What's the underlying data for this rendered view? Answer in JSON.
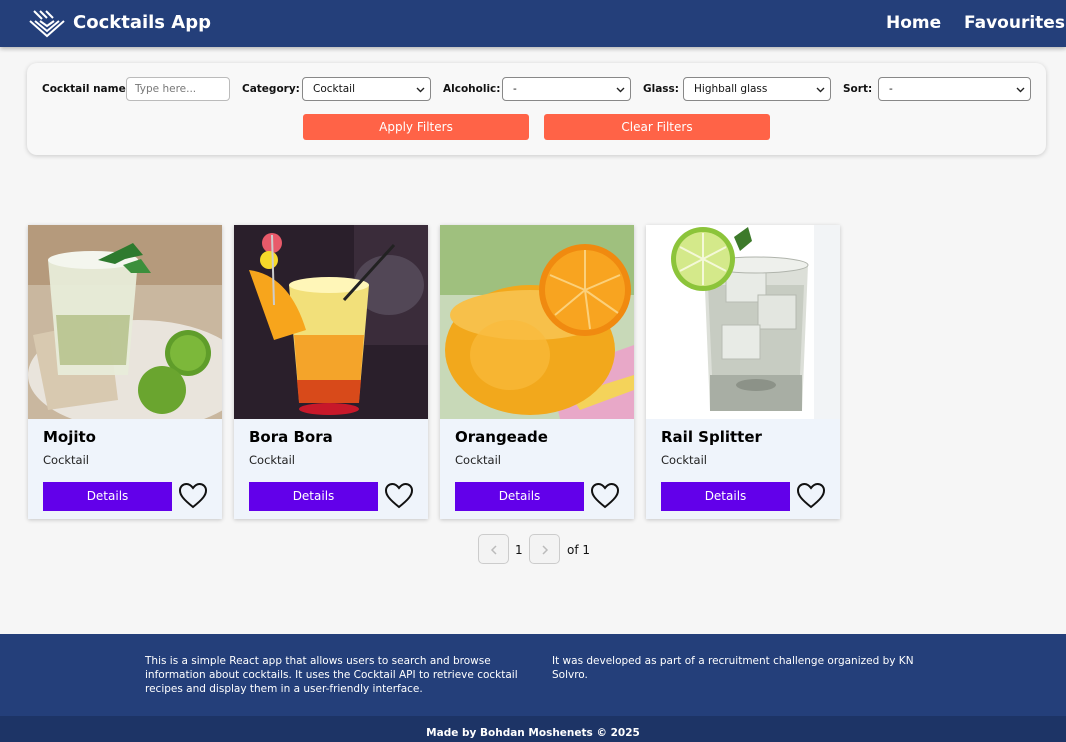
{
  "header": {
    "app_title": "Cocktails App",
    "nav": {
      "home": "Home",
      "favourites": "Favourites"
    },
    "background_color": "#243f7a"
  },
  "filters": {
    "name_label": "Cocktail name:",
    "name_placeholder": "Type here...",
    "category_label": "Category:",
    "category_value": "Cocktail",
    "alcoholic_label": "Alcoholic:",
    "alcoholic_value": "-",
    "glass_label": "Glass:",
    "glass_value": "Highball glass",
    "sort_label": "Sort:",
    "sort_value": "-",
    "apply_label": "Apply Filters",
    "clear_label": "Clear Filters",
    "button_color": "#ff6347"
  },
  "cocktails": [
    {
      "name": "Mojito",
      "category": "Cocktail",
      "details_label": "Details"
    },
    {
      "name": "Bora Bora",
      "category": "Cocktail",
      "details_label": "Details"
    },
    {
      "name": "Orangeade",
      "category": "Cocktail",
      "details_label": "Details"
    },
    {
      "name": "Rail Splitter",
      "category": "Cocktail",
      "details_label": "Details"
    }
  ],
  "pagination": {
    "current_page": "1",
    "total_label": "of 1"
  },
  "footer": {
    "about": "This is a simple React app that allows users to search and browse information about cocktails. It uses the Cocktail API to retrieve cocktail recipes and display them in a user-friendly interface.",
    "challenge": "It was developed as part of a recruitment challenge organized by KN Solvro.",
    "made_by": "Made by Bohdan Moshenets © 2025"
  },
  "colors": {
    "details_button": "#6200ea",
    "footer": "#243f7a",
    "bottom_bar": "#1d3466"
  }
}
